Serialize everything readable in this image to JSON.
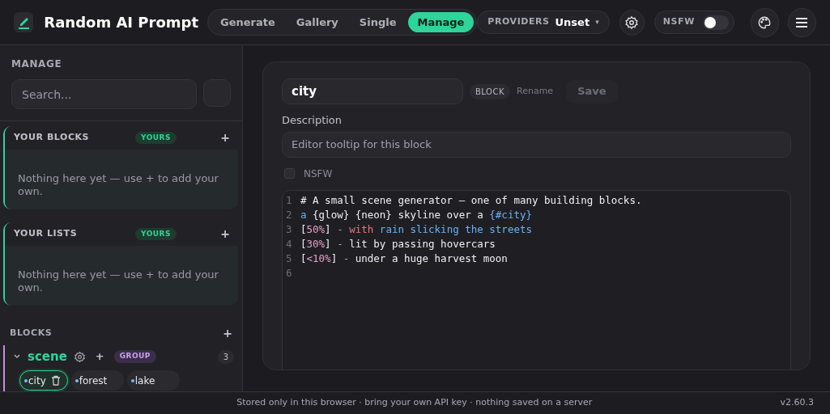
{
  "app": {
    "title": "Random AI Prompt"
  },
  "nav_tabs": [
    {
      "label": "Generate",
      "selected": false
    },
    {
      "label": "Gallery",
      "selected": false
    },
    {
      "label": "Single",
      "selected": false
    },
    {
      "label": "Manage",
      "selected": true
    }
  ],
  "providers": {
    "label": "PROVIDERS",
    "value": "Unset",
    "caret": "▾"
  },
  "nsfw_toggle": {
    "label": "NSFW",
    "on": false
  },
  "sidebar": {
    "title": "MANAGE",
    "search": {
      "placeholder": "Search..."
    },
    "sections": [
      {
        "title": "YOUR BLOCKS",
        "badge": "YOURS",
        "add": "+",
        "empty_text": "Nothing here yet — use + to add your own."
      },
      {
        "title": "YOUR LISTS",
        "badge": "YOURS",
        "add": "+",
        "empty_text": "Nothing here yet — use + to add your own."
      }
    ],
    "blocks": {
      "title": "BLOCKS",
      "add": "+",
      "groups": [
        {
          "name": "scene",
          "add": "+",
          "badge": "GROUP",
          "count": "3",
          "expanded": true,
          "items": [
            {
              "label": "city",
              "selected": true
            },
            {
              "label": "forest",
              "selected": false
            },
            {
              "label": "lake",
              "selected": false
            }
          ]
        }
      ]
    }
  },
  "editor": {
    "name_value": "city",
    "type_badge": "BLOCK",
    "rename": "Rename",
    "save": "Save",
    "description_label": "Description",
    "description_placeholder": "Editor tooltip for this block",
    "nsfw": {
      "label": "NSFW",
      "checked": false
    },
    "code_lines": [
      {
        "number": "1",
        "tokens": [
          {
            "text": "# A small scene generator — one of many building blocks.",
            "kind": "plain"
          }
        ]
      },
      {
        "number": "2",
        "tokens": [
          {
            "text": "a",
            "kind": "ref"
          },
          {
            "text": " {glow} {neon} skyline over a ",
            "kind": "plain"
          },
          {
            "text": "{#city}",
            "kind": "ref"
          }
        ]
      },
      {
        "number": "3",
        "tokens": [
          {
            "text": "[",
            "kind": "plain"
          },
          {
            "text": "50%",
            "kind": "weight"
          },
          {
            "text": "]",
            "kind": "plain"
          },
          {
            "text": " - ",
            "kind": "muted"
          },
          {
            "text": "with",
            "kind": "keyword"
          },
          {
            "text": " rain slicking the streets",
            "kind": "ref"
          }
        ]
      },
      {
        "number": "4",
        "tokens": [
          {
            "text": "[",
            "kind": "plain"
          },
          {
            "text": "30%",
            "kind": "weight"
          },
          {
            "text": "]",
            "kind": "plain"
          },
          {
            "text": " - ",
            "kind": "muted"
          },
          {
            "text": "lit by passing hovercars",
            "kind": "plain"
          }
        ]
      },
      {
        "number": "5",
        "tokens": [
          {
            "text": "[",
            "kind": "plain"
          },
          {
            "text": "<10%",
            "kind": "weight"
          },
          {
            "text": "]",
            "kind": "plain"
          },
          {
            "text": " - ",
            "kind": "muted"
          },
          {
            "text": "under a huge harvest moon",
            "kind": "plain"
          }
        ]
      },
      {
        "number": "6"
      }
    ]
  },
  "footer": {
    "note": "Stored only in this browser · bring your own API key · nothing saved on a server",
    "version": "v2.60.3"
  }
}
